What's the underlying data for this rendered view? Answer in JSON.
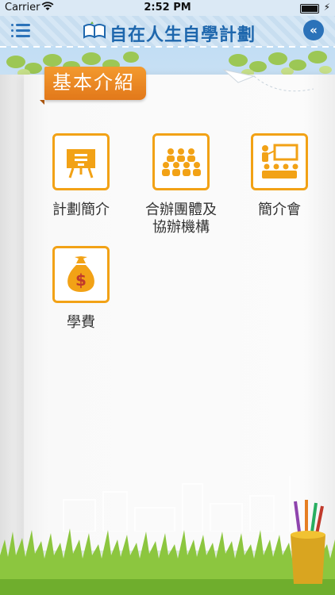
{
  "status_bar": {
    "carrier": "Carrier",
    "time": "2:52 PM"
  },
  "header": {
    "title": "自在人生自學計劃"
  },
  "section": {
    "title": "基本介紹"
  },
  "items": [
    {
      "label": "計劃簡介",
      "icon": "presentation-board-icon"
    },
    {
      "label": "合辦團體及協辦機構",
      "icon": "group-people-icon"
    },
    {
      "label": "簡介會",
      "icon": "briefing-session-icon"
    },
    {
      "label": "學費",
      "icon": "money-bag-icon"
    }
  ],
  "colors": {
    "accent": "#F2A216",
    "brand_blue": "#2B72B9",
    "tag_orange": "#EC8A24"
  }
}
